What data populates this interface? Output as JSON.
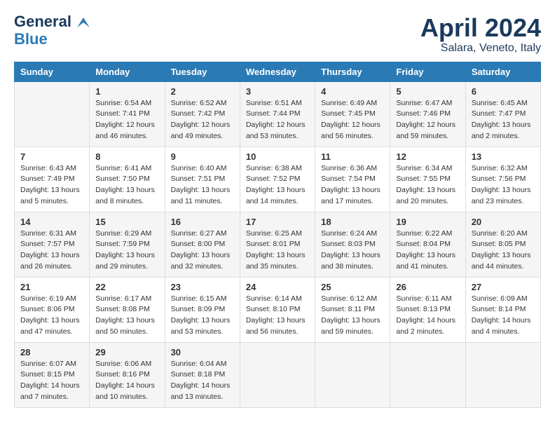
{
  "header": {
    "logo_general": "General",
    "logo_blue": "Blue",
    "month_title": "April 2024",
    "location": "Salara, Veneto, Italy"
  },
  "days_of_week": [
    "Sunday",
    "Monday",
    "Tuesday",
    "Wednesday",
    "Thursday",
    "Friday",
    "Saturday"
  ],
  "weeks": [
    [
      {
        "day": "",
        "sunrise": "",
        "sunset": "",
        "daylight": ""
      },
      {
        "day": "1",
        "sunrise": "Sunrise: 6:54 AM",
        "sunset": "Sunset: 7:41 PM",
        "daylight": "Daylight: 12 hours and 46 minutes."
      },
      {
        "day": "2",
        "sunrise": "Sunrise: 6:52 AM",
        "sunset": "Sunset: 7:42 PM",
        "daylight": "Daylight: 12 hours and 49 minutes."
      },
      {
        "day": "3",
        "sunrise": "Sunrise: 6:51 AM",
        "sunset": "Sunset: 7:44 PM",
        "daylight": "Daylight: 12 hours and 53 minutes."
      },
      {
        "day": "4",
        "sunrise": "Sunrise: 6:49 AM",
        "sunset": "Sunset: 7:45 PM",
        "daylight": "Daylight: 12 hours and 56 minutes."
      },
      {
        "day": "5",
        "sunrise": "Sunrise: 6:47 AM",
        "sunset": "Sunset: 7:46 PM",
        "daylight": "Daylight: 12 hours and 59 minutes."
      },
      {
        "day": "6",
        "sunrise": "Sunrise: 6:45 AM",
        "sunset": "Sunset: 7:47 PM",
        "daylight": "Daylight: 13 hours and 2 minutes."
      }
    ],
    [
      {
        "day": "7",
        "sunrise": "Sunrise: 6:43 AM",
        "sunset": "Sunset: 7:49 PM",
        "daylight": "Daylight: 13 hours and 5 minutes."
      },
      {
        "day": "8",
        "sunrise": "Sunrise: 6:41 AM",
        "sunset": "Sunset: 7:50 PM",
        "daylight": "Daylight: 13 hours and 8 minutes."
      },
      {
        "day": "9",
        "sunrise": "Sunrise: 6:40 AM",
        "sunset": "Sunset: 7:51 PM",
        "daylight": "Daylight: 13 hours and 11 minutes."
      },
      {
        "day": "10",
        "sunrise": "Sunrise: 6:38 AM",
        "sunset": "Sunset: 7:52 PM",
        "daylight": "Daylight: 13 hours and 14 minutes."
      },
      {
        "day": "11",
        "sunrise": "Sunrise: 6:36 AM",
        "sunset": "Sunset: 7:54 PM",
        "daylight": "Daylight: 13 hours and 17 minutes."
      },
      {
        "day": "12",
        "sunrise": "Sunrise: 6:34 AM",
        "sunset": "Sunset: 7:55 PM",
        "daylight": "Daylight: 13 hours and 20 minutes."
      },
      {
        "day": "13",
        "sunrise": "Sunrise: 6:32 AM",
        "sunset": "Sunset: 7:56 PM",
        "daylight": "Daylight: 13 hours and 23 minutes."
      }
    ],
    [
      {
        "day": "14",
        "sunrise": "Sunrise: 6:31 AM",
        "sunset": "Sunset: 7:57 PM",
        "daylight": "Daylight: 13 hours and 26 minutes."
      },
      {
        "day": "15",
        "sunrise": "Sunrise: 6:29 AM",
        "sunset": "Sunset: 7:59 PM",
        "daylight": "Daylight: 13 hours and 29 minutes."
      },
      {
        "day": "16",
        "sunrise": "Sunrise: 6:27 AM",
        "sunset": "Sunset: 8:00 PM",
        "daylight": "Daylight: 13 hours and 32 minutes."
      },
      {
        "day": "17",
        "sunrise": "Sunrise: 6:25 AM",
        "sunset": "Sunset: 8:01 PM",
        "daylight": "Daylight: 13 hours and 35 minutes."
      },
      {
        "day": "18",
        "sunrise": "Sunrise: 6:24 AM",
        "sunset": "Sunset: 8:03 PM",
        "daylight": "Daylight: 13 hours and 38 minutes."
      },
      {
        "day": "19",
        "sunrise": "Sunrise: 6:22 AM",
        "sunset": "Sunset: 8:04 PM",
        "daylight": "Daylight: 13 hours and 41 minutes."
      },
      {
        "day": "20",
        "sunrise": "Sunrise: 6:20 AM",
        "sunset": "Sunset: 8:05 PM",
        "daylight": "Daylight: 13 hours and 44 minutes."
      }
    ],
    [
      {
        "day": "21",
        "sunrise": "Sunrise: 6:19 AM",
        "sunset": "Sunset: 8:06 PM",
        "daylight": "Daylight: 13 hours and 47 minutes."
      },
      {
        "day": "22",
        "sunrise": "Sunrise: 6:17 AM",
        "sunset": "Sunset: 8:08 PM",
        "daylight": "Daylight: 13 hours and 50 minutes."
      },
      {
        "day": "23",
        "sunrise": "Sunrise: 6:15 AM",
        "sunset": "Sunset: 8:09 PM",
        "daylight": "Daylight: 13 hours and 53 minutes."
      },
      {
        "day": "24",
        "sunrise": "Sunrise: 6:14 AM",
        "sunset": "Sunset: 8:10 PM",
        "daylight": "Daylight: 13 hours and 56 minutes."
      },
      {
        "day": "25",
        "sunrise": "Sunrise: 6:12 AM",
        "sunset": "Sunset: 8:11 PM",
        "daylight": "Daylight: 13 hours and 59 minutes."
      },
      {
        "day": "26",
        "sunrise": "Sunrise: 6:11 AM",
        "sunset": "Sunset: 8:13 PM",
        "daylight": "Daylight: 14 hours and 2 minutes."
      },
      {
        "day": "27",
        "sunrise": "Sunrise: 6:09 AM",
        "sunset": "Sunset: 8:14 PM",
        "daylight": "Daylight: 14 hours and 4 minutes."
      }
    ],
    [
      {
        "day": "28",
        "sunrise": "Sunrise: 6:07 AM",
        "sunset": "Sunset: 8:15 PM",
        "daylight": "Daylight: 14 hours and 7 minutes."
      },
      {
        "day": "29",
        "sunrise": "Sunrise: 6:06 AM",
        "sunset": "Sunset: 8:16 PM",
        "daylight": "Daylight: 14 hours and 10 minutes."
      },
      {
        "day": "30",
        "sunrise": "Sunrise: 6:04 AM",
        "sunset": "Sunset: 8:18 PM",
        "daylight": "Daylight: 14 hours and 13 minutes."
      },
      {
        "day": "",
        "sunrise": "",
        "sunset": "",
        "daylight": ""
      },
      {
        "day": "",
        "sunrise": "",
        "sunset": "",
        "daylight": ""
      },
      {
        "day": "",
        "sunrise": "",
        "sunset": "",
        "daylight": ""
      },
      {
        "day": "",
        "sunrise": "",
        "sunset": "",
        "daylight": ""
      }
    ]
  ]
}
